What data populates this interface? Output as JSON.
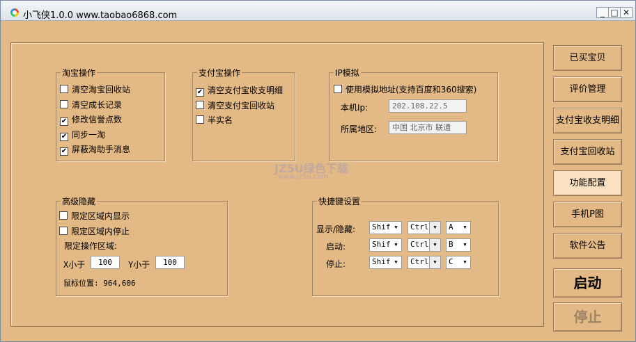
{
  "window": {
    "title": "小飞侠1.0.0 www.taobao6868.com",
    "controls": {
      "minimize": "_",
      "maximize": "□",
      "close": "✕"
    }
  },
  "groups": {
    "taobao": {
      "title": "淘宝操作",
      "items": [
        {
          "label": "清空淘宝回收站",
          "checked": false
        },
        {
          "label": "清空成长记录",
          "checked": false
        },
        {
          "label": "修改信誉点数",
          "checked": true
        },
        {
          "label": "同步一淘",
          "checked": true
        },
        {
          "label": "屏蔽淘助手消息",
          "checked": true
        }
      ]
    },
    "alipay": {
      "title": "支付宝操作",
      "items": [
        {
          "label": "清空支付宝收支明细",
          "checked": true
        },
        {
          "label": "清空支付宝回收站",
          "checked": false
        },
        {
          "label": "半实名",
          "checked": false
        }
      ]
    },
    "ip": {
      "title": "IP模拟",
      "use_sim": {
        "label": "使用模拟地址(支持百度和360搜索)",
        "checked": false
      },
      "local_ip_label": "本机Ip:",
      "local_ip_value": "202.108.22.5",
      "region_label": "所属地区:",
      "region_value": "中国 北京市 联通"
    },
    "hide": {
      "title": "高级隐藏",
      "items": [
        {
          "label": "限定区域内显示",
          "checked": false
        },
        {
          "label": "限定区域内停止",
          "checked": false
        }
      ],
      "area_label": "限定操作区域:",
      "x_label": "X小于",
      "x_value": "100",
      "y_label": "Y小于",
      "y_value": "100",
      "mouse_pos": "鼠标位置: 964,606"
    },
    "hotkeys": {
      "title": "快捷键设置",
      "rows": [
        {
          "label": "显示/隐藏:",
          "mod1": "Shif",
          "mod2": "Ctrl",
          "key": "A"
        },
        {
          "label": "启动:",
          "mod1": "Shif",
          "mod2": "Ctrl",
          "key": "B"
        },
        {
          "label": "停止:",
          "mod1": "Shif",
          "mod2": "Ctrl",
          "key": "C"
        }
      ]
    }
  },
  "sidebar": {
    "buttons": [
      "已买宝贝",
      "评价管理",
      "支付宝收支明细",
      "支付宝回收站",
      "功能配置",
      "手机P图",
      "软件公告"
    ],
    "active": "功能配置",
    "start": "启动",
    "stop": "停止"
  },
  "watermark": {
    "line1": "JZ5U绿色下载",
    "line2": "www.jz5u.com"
  }
}
